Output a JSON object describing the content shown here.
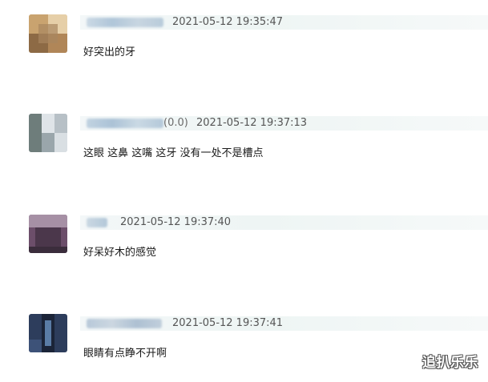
{
  "comments": [
    {
      "suffix": "",
      "timestamp": "2021-05-12 19:35:47",
      "text": "好突出的牙",
      "avatar_colors": [
        "#c8a06a",
        "#8d6a45",
        "#e2c9a2"
      ]
    },
    {
      "suffix": "(0.0)",
      "timestamp": "2021-05-12 19:37:13",
      "text": "这眼 这鼻 这嘴 这牙 没有一处不是槽点",
      "avatar_colors": [
        "#b9c2c8",
        "#5d6d6b",
        "#e1e6ea"
      ]
    },
    {
      "suffix": "",
      "timestamp": "2021-05-12 19:37:40",
      "text": "好呆好木的感觉",
      "avatar_colors": [
        "#6c4e6a",
        "#a690a5",
        "#3b2d3c"
      ]
    },
    {
      "suffix": "",
      "timestamp": "2021-05-12 19:37:41",
      "text": "眼睛有点睁不开啊",
      "avatar_colors": [
        "#2d3d5c",
        "#5a7ca6",
        "#1b2438"
      ]
    }
  ],
  "watermark": "追扒乐乐",
  "colors": {
    "meta_band": "#eef5f4",
    "timestamp": "#555555",
    "comment_text": "#1a1a1a",
    "blurred_name": "#b5c9d8"
  }
}
